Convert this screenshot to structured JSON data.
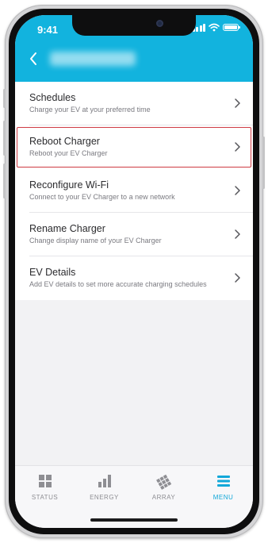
{
  "status_bar": {
    "time": "9:41"
  },
  "header": {
    "back_icon": "chevron-left-icon"
  },
  "menu": {
    "items": [
      {
        "title": "Schedules",
        "subtitle": "Charge your EV at your preferred time",
        "icon": "chevron-right-icon",
        "highlighted": false
      },
      {
        "title": "Reboot Charger",
        "subtitle": "Reboot your EV Charger",
        "icon": "chevron-right-icon",
        "highlighted": true
      },
      {
        "title": "Reconfigure Wi-Fi",
        "subtitle": "Connect to your EV Charger to a new network",
        "icon": "chevron-right-icon",
        "highlighted": false
      },
      {
        "title": "Rename Charger",
        "subtitle": "Change display name of your EV Charger",
        "icon": "chevron-right-icon",
        "highlighted": false
      },
      {
        "title": "EV Details",
        "subtitle": "Add EV details to set more accurate charging schedules",
        "icon": "chevron-right-icon",
        "highlighted": false
      }
    ]
  },
  "tabbar": {
    "tabs": [
      {
        "label": "STATUS",
        "icon": "grid-icon",
        "active": false
      },
      {
        "label": "ENERGY",
        "icon": "bar-chart-icon",
        "active": false
      },
      {
        "label": "ARRAY",
        "icon": "solar-panel-icon",
        "active": false
      },
      {
        "label": "MENU",
        "icon": "hamburger-menu-icon",
        "active": true
      }
    ]
  },
  "colors": {
    "accent": "#12b3de",
    "highlight_border": "#cf3b44",
    "tab_active": "#12a8d9",
    "tab_inactive": "#8e8e93"
  }
}
